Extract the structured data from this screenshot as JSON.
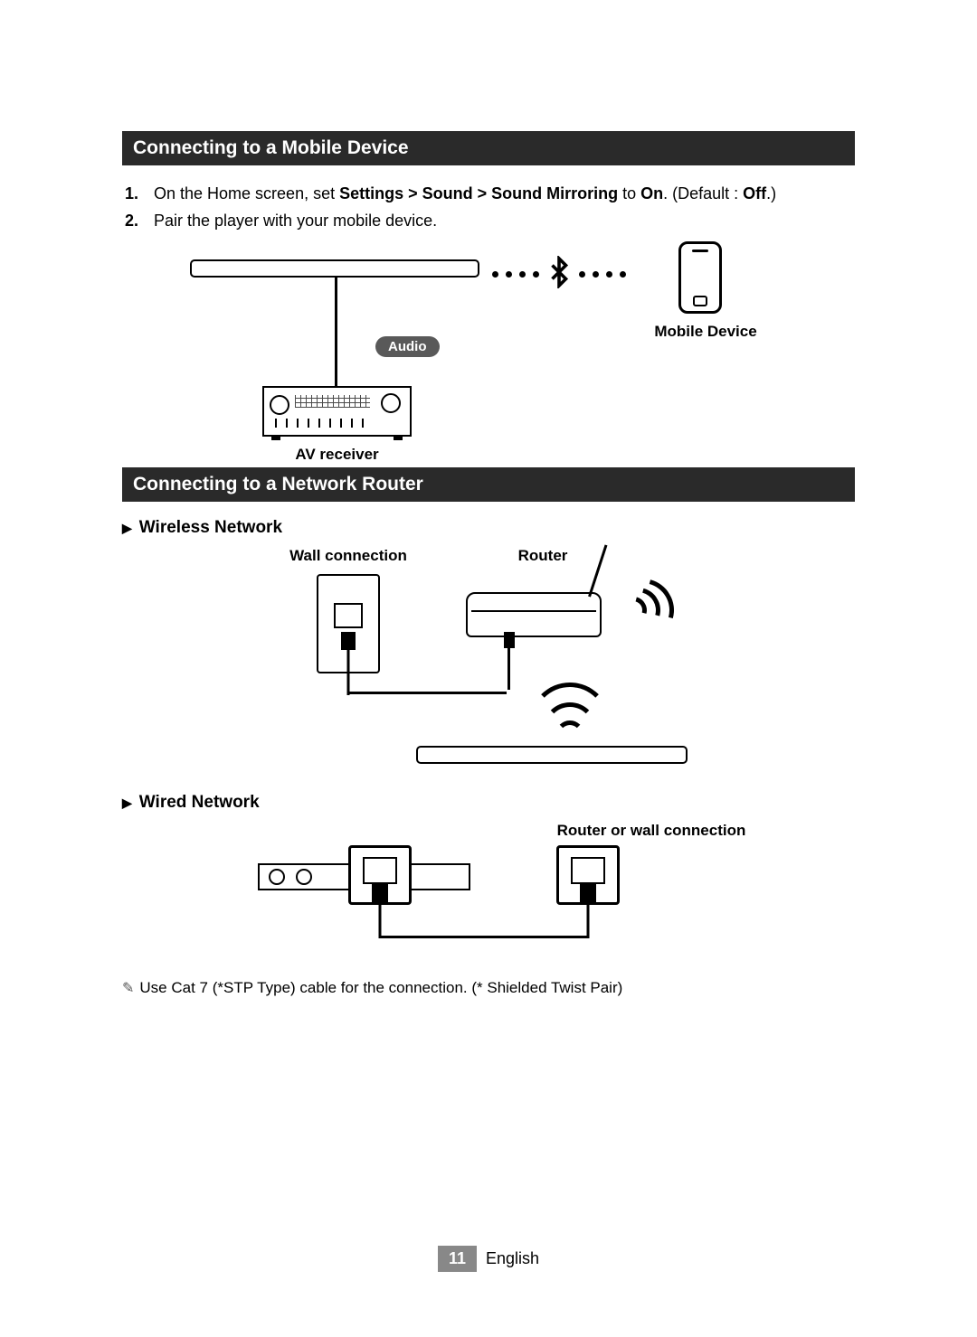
{
  "section1": {
    "title": "Connecting to a Mobile Device",
    "step1_a": "On the Home screen, set ",
    "step1_b": "Settings > Sound > Sound Mirroring",
    "step1_c": " to ",
    "step1_d": "On",
    "step1_e": ". (Default : ",
    "step1_f": "Off",
    "step1_g": ".)",
    "step2": "Pair the player with your mobile device.",
    "label_mobile": "Mobile Device",
    "pill_audio": "Audio",
    "label_receiver": "AV receiver"
  },
  "section2": {
    "title": "Connecting to a Network Router",
    "sub_wireless": "Wireless Network",
    "label_wall": "Wall connection",
    "label_router": "Router",
    "sub_wired": "Wired Network",
    "label_routerwall": "Router or wall connection",
    "note": "Use Cat 7 (*STP Type) cable for the connection. (* Shielded Twist Pair)"
  },
  "footer": {
    "page": "11",
    "lang": "English"
  }
}
